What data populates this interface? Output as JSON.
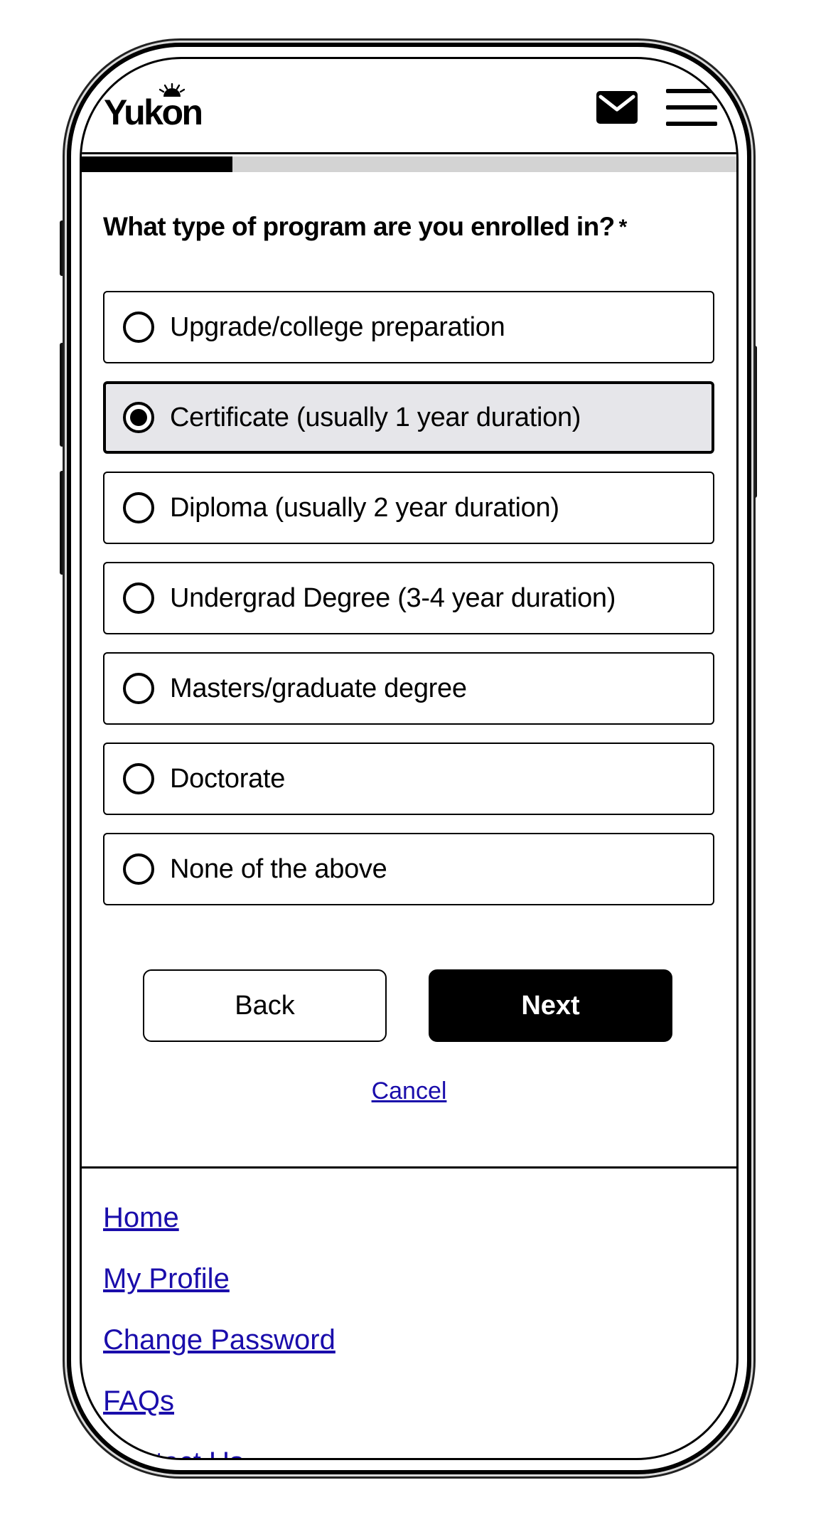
{
  "header": {
    "logo_text": "Yukon",
    "mail_icon": "envelope-icon",
    "menu_icon": "hamburger-menu-icon"
  },
  "progress": {
    "fraction": 0.23
  },
  "form": {
    "question": "What type of program are you enrolled in?",
    "required_marker": "*",
    "options": [
      {
        "label": "Upgrade/college preparation",
        "selected": false
      },
      {
        "label": "Certificate (usually 1 year duration)",
        "selected": true
      },
      {
        "label": "Diploma (usually 2 year duration)",
        "selected": false
      },
      {
        "label": "Undergrad Degree (3-4 year duration)",
        "selected": false
      },
      {
        "label": "Masters/graduate degree",
        "selected": false
      },
      {
        "label": "Doctorate",
        "selected": false
      },
      {
        "label": "None of the above",
        "selected": false
      }
    ]
  },
  "buttons": {
    "back_label": "Back",
    "next_label": "Next"
  },
  "cancel_label": "Cancel",
  "footer": {
    "links": [
      "Home",
      "My Profile",
      "Change Password",
      "FAQs",
      "Contact Us"
    ]
  },
  "colors": {
    "link": "#1a0dab",
    "selected_bg": "#e6e6ea",
    "progress_track": "#d3d3d3"
  }
}
